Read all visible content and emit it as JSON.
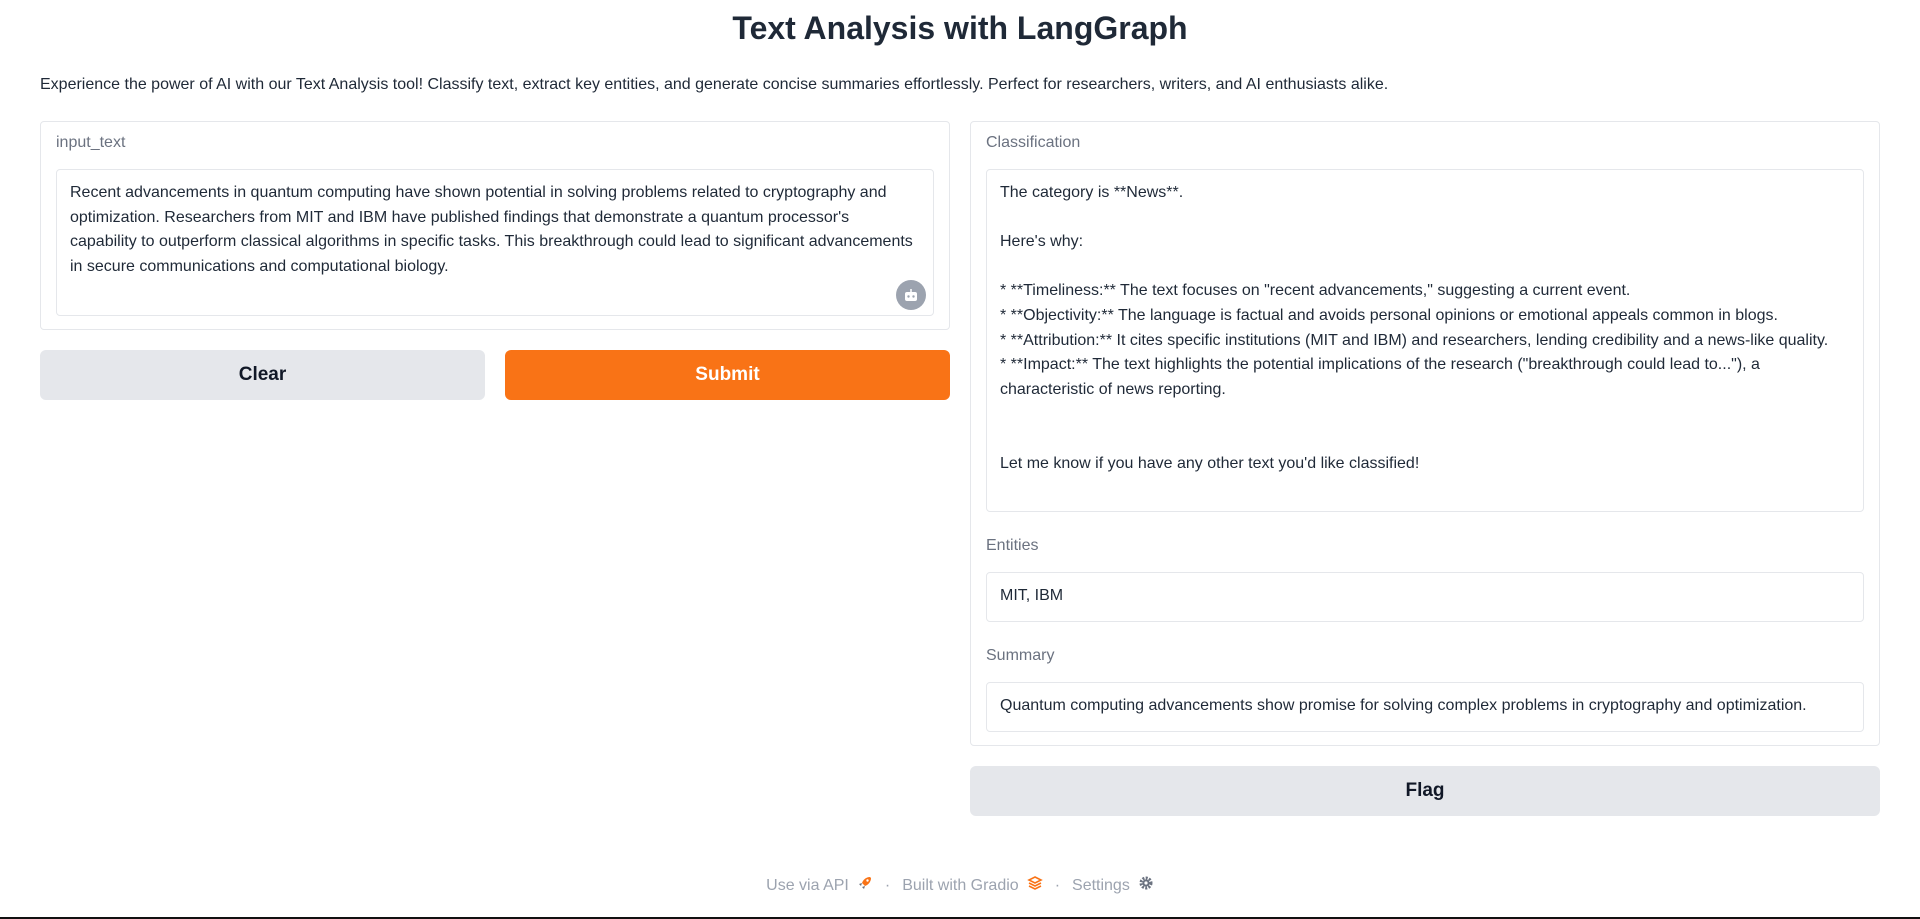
{
  "header": {
    "title": "Text Analysis with LangGraph",
    "description": "Experience the power of AI with our Text Analysis tool! Classify text, extract key entities, and generate concise summaries effortlessly. Perfect for researchers, writers, and AI enthusiasts alike."
  },
  "input": {
    "label": "input_text",
    "value": "Recent advancements in quantum computing have shown potential in solving problems related to cryptography and optimization. Researchers from MIT and IBM have published findings that demonstrate a quantum processor's capability to outperform classical algorithms in specific tasks. This breakthrough could lead to significant advancements in secure communications and computational biology.",
    "icon": "bot-icon"
  },
  "buttons": {
    "clear": "Clear",
    "submit": "Submit",
    "flag": "Flag"
  },
  "outputs": {
    "classification": {
      "label": "Classification",
      "value": "The category is **News**.\n\nHere's why:\n\n* **Timeliness:** The text focuses on \"recent advancements,\" suggesting a current event.\n* **Objectivity:** The language is factual and avoids personal opinions or emotional appeals common in blogs.\n* **Attribution:** It cites specific institutions (MIT and IBM) and researchers, lending credibility and a news-like quality.\n* **Impact:** The text highlights the potential implications of the research (\"breakthrough could lead to...\"), a characteristic of news reporting.\n\n\nLet me know if you have any other text you'd like classified!"
    },
    "entities": {
      "label": "Entities",
      "value": "MIT, IBM"
    },
    "summary": {
      "label": "Summary",
      "value": "Quantum computing advancements show promise for solving complex problems in cryptography and optimization."
    }
  },
  "footer": {
    "api": "Use via API",
    "built": "Built with Gradio",
    "settings": "Settings",
    "separator": "·"
  },
  "colors": {
    "accent": "#f97316",
    "neutral_button": "#e5e7eb",
    "label": "#6b7280"
  }
}
